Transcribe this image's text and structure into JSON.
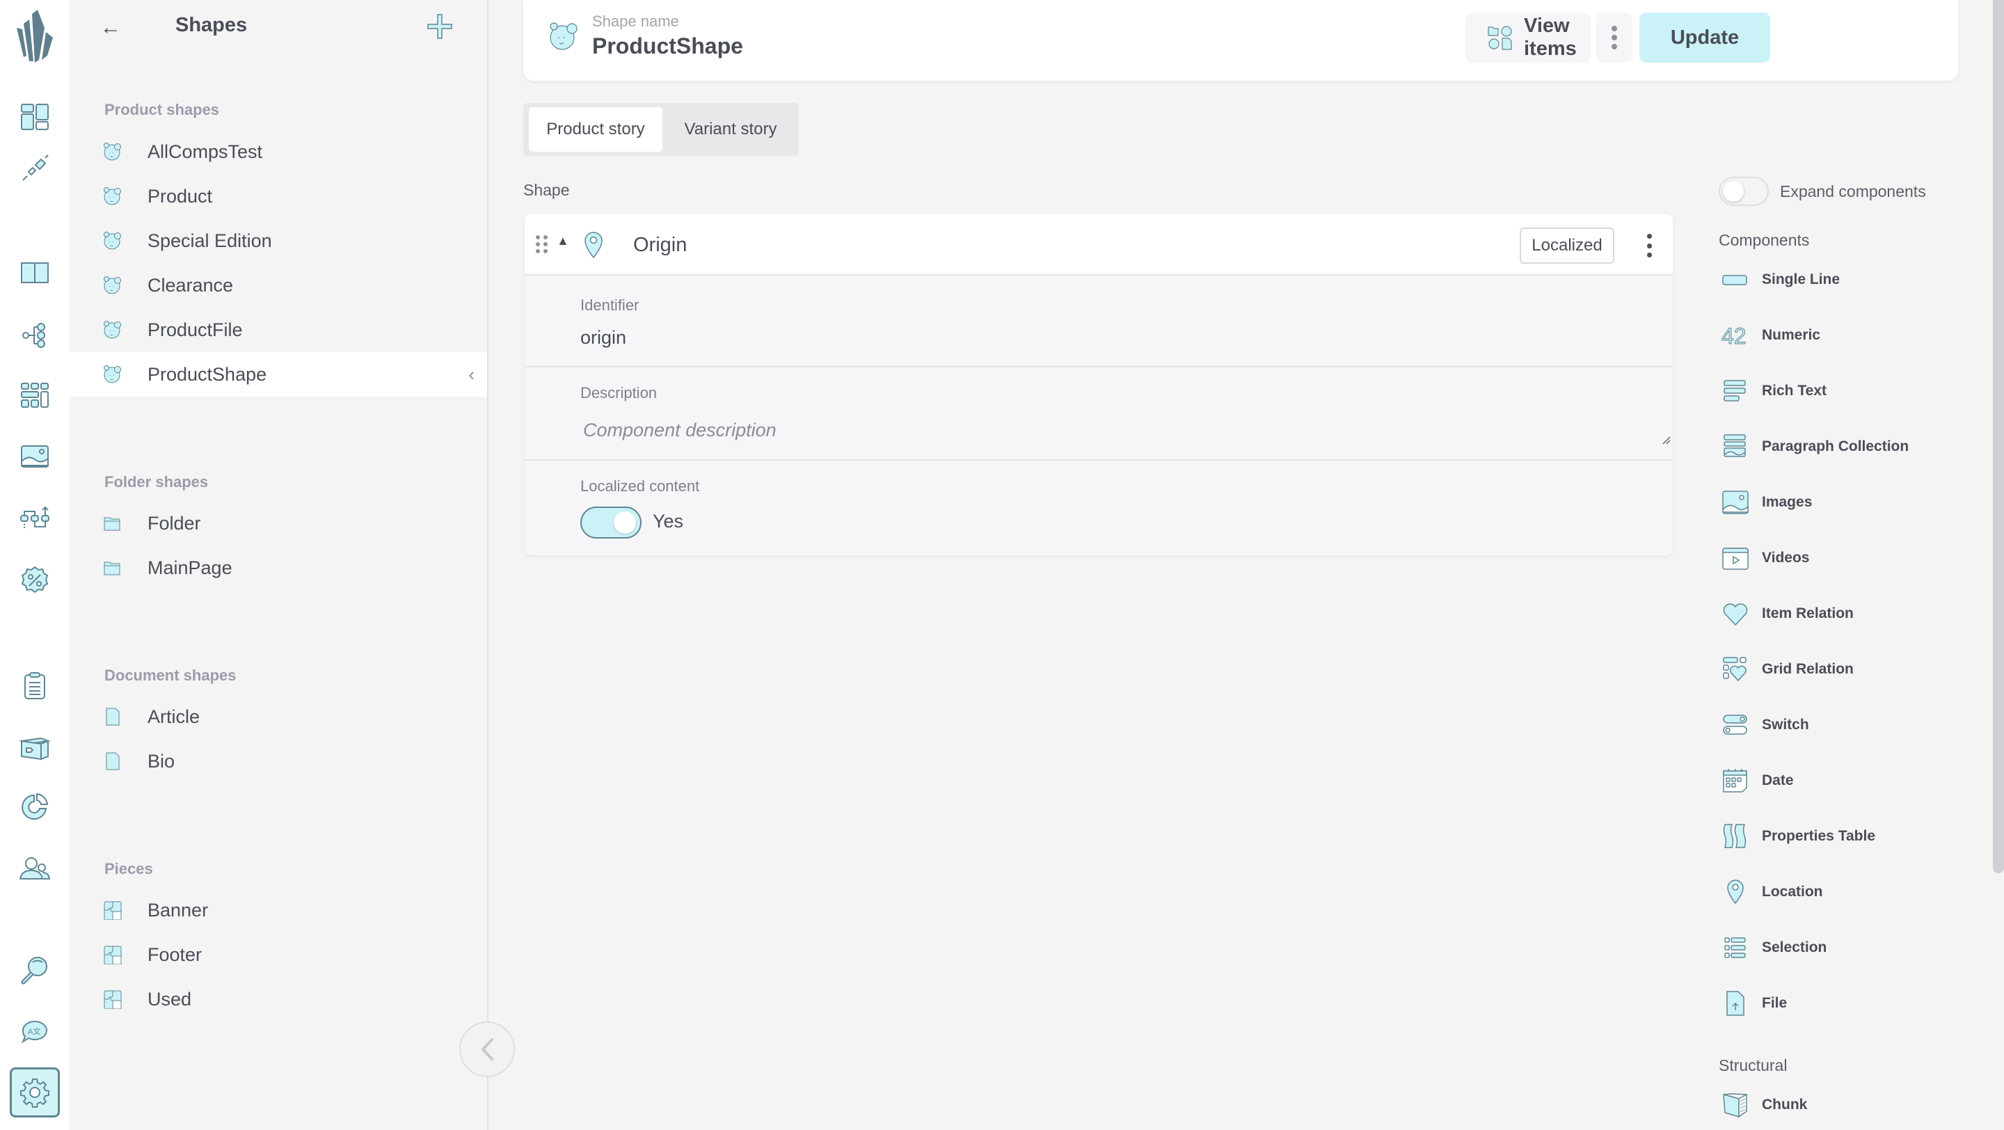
{
  "nav": {
    "items": [
      {
        "name": "dashboard",
        "icon": "dashboard-icon"
      },
      {
        "name": "integrations",
        "icon": "plug-icon"
      },
      {
        "name": "catalogue",
        "icon": "book-icon"
      },
      {
        "name": "topics",
        "icon": "tree-icon"
      },
      {
        "name": "grids",
        "icon": "grid-icon"
      },
      {
        "name": "media",
        "icon": "image-icon"
      },
      {
        "name": "flows",
        "icon": "flow-icon"
      },
      {
        "name": "price-variants",
        "icon": "percent-badge-icon"
      },
      {
        "name": "orders",
        "icon": "clipboard-icon"
      },
      {
        "name": "fulfilment",
        "icon": "box-icon"
      },
      {
        "name": "analytics",
        "icon": "pie-chart-icon"
      },
      {
        "name": "customers",
        "icon": "users-icon"
      },
      {
        "name": "search",
        "icon": "search-icon"
      },
      {
        "name": "translations",
        "icon": "translate-icon"
      },
      {
        "name": "settings",
        "icon": "gear-icon",
        "active": true
      }
    ]
  },
  "shapes_panel": {
    "title": "Shapes",
    "back_icon": "arrow-left-icon",
    "add_icon": "plus-icon",
    "groups": [
      {
        "title": "Product shapes",
        "icon": "product-shape-icon",
        "items": [
          "AllCompsTest",
          "Product",
          "Special Edition",
          "Clearance",
          "ProductFile",
          "ProductShape"
        ],
        "active_index": 5
      },
      {
        "title": "Folder shapes",
        "icon": "folder-icon",
        "items": [
          "Folder",
          "MainPage"
        ]
      },
      {
        "title": "Document shapes",
        "icon": "document-icon",
        "items": [
          "Article",
          "Bio"
        ]
      },
      {
        "title": "Pieces",
        "icon": "puzzle-icon",
        "items": [
          "Banner",
          "Footer",
          "Used"
        ]
      }
    ]
  },
  "header": {
    "shape_name_label": "Shape name",
    "shape_name": "ProductShape",
    "view_items_label": "View items",
    "update_label": "Update"
  },
  "tabs": [
    {
      "label": "Product story",
      "active": true
    },
    {
      "label": "Variant story",
      "active": false
    }
  ],
  "shape_section": {
    "label": "Shape",
    "component": {
      "name": "Origin",
      "type_icon": "location-icon",
      "badge": "Localized",
      "identifier_label": "Identifier",
      "identifier_value": "origin",
      "description_label": "Description",
      "description_value": "",
      "description_placeholder": "Component description",
      "localized_label": "Localized content",
      "localized_value": true,
      "localized_text": "Yes"
    }
  },
  "components_panel": {
    "expand_label": "Expand components",
    "expand_value": false,
    "components_title": "Components",
    "components": [
      {
        "label": "Single Line",
        "icon": "single-line-icon"
      },
      {
        "label": "Numeric",
        "icon": "numeric-icon"
      },
      {
        "label": "Rich Text",
        "icon": "rich-text-icon"
      },
      {
        "label": "Paragraph Collection",
        "icon": "paragraph-collection-icon"
      },
      {
        "label": "Images",
        "icon": "images-icon"
      },
      {
        "label": "Videos",
        "icon": "videos-icon"
      },
      {
        "label": "Item Relation",
        "icon": "heart-icon"
      },
      {
        "label": "Grid Relation",
        "icon": "grid-relation-icon"
      },
      {
        "label": "Switch",
        "icon": "switch-icon"
      },
      {
        "label": "Date",
        "icon": "calendar-icon"
      },
      {
        "label": "Properties Table",
        "icon": "properties-table-icon"
      },
      {
        "label": "Location",
        "icon": "location-icon"
      },
      {
        "label": "Selection",
        "icon": "selection-icon"
      },
      {
        "label": "File",
        "icon": "file-upload-icon"
      }
    ],
    "structural_title": "Structural",
    "structural": [
      {
        "label": "Chunk",
        "icon": "chunk-icon"
      }
    ]
  },
  "colors": {
    "accent_fill": "#cbf3f7",
    "icon_stroke": "#5f8593",
    "logo": "#5f7f8c",
    "text": "#4a4d57",
    "muted": "#9a9cab"
  }
}
